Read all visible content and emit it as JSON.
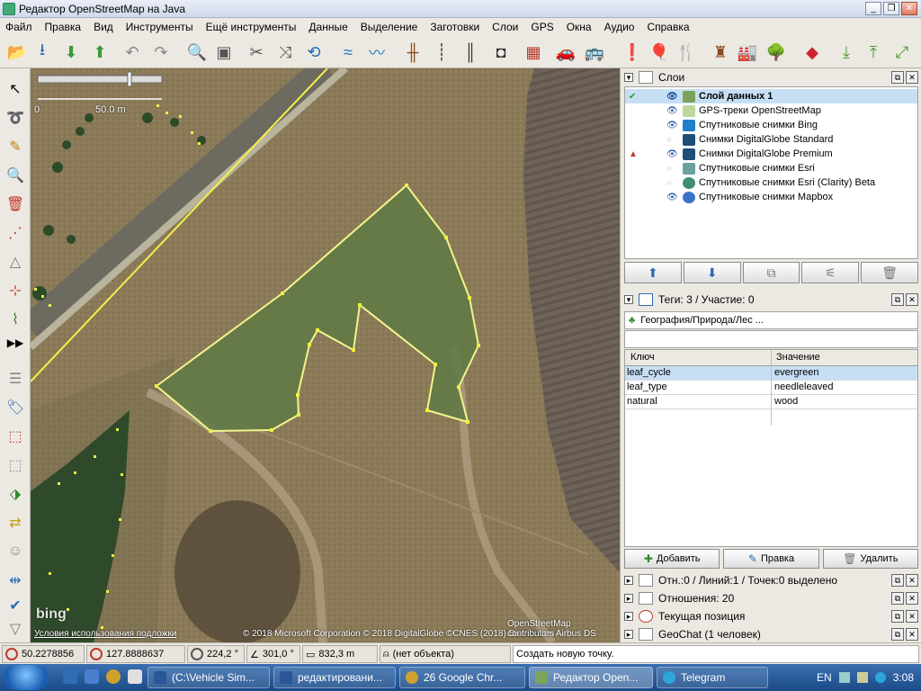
{
  "window": {
    "title": "Редактор OpenStreetMap на Java",
    "min_label": "_",
    "max_label": "❐",
    "close_label": "✕"
  },
  "menu": [
    "Файл",
    "Правка",
    "Вид",
    "Инструменты",
    "Ещё инструменты",
    "Данные",
    "Выделение",
    "Заготовки",
    "Слои",
    "GPS",
    "Окна",
    "Аудио",
    "Справка"
  ],
  "map": {
    "scale_zero": "0",
    "scale_label": "50.0 m",
    "bing_logo": "bing",
    "terms_link": "Условия использования подложки",
    "copyright": "© 2018 Microsoft Corporation © 2018 DigitalGlobe ©CNES (2018) Distribution Airbus DS",
    "osm_contrib": "OpenStreetMap contributors",
    "colors": {
      "polygon": "#f2f58a",
      "nodes": "#f0f040",
      "road": "#f4ef4a"
    }
  },
  "layers_panel": {
    "title": "Слои",
    "layers": [
      {
        "name": "Слой данных 1",
        "active": true,
        "visible": true,
        "icon": "data-layer-icon",
        "color": "#7aa45a"
      },
      {
        "name": "GPS-треки OpenStreetMap",
        "active": false,
        "visible": true,
        "icon": "gps-track-icon",
        "color": "#bcd89c"
      },
      {
        "name": "Спутниковые снимки Bing",
        "active": false,
        "visible": true,
        "icon": "bing-icon",
        "color": "#1f7fc8"
      },
      {
        "name": "Снимки DigitalGlobe Standard",
        "active": false,
        "visible": false,
        "icon": "digitalglobe-icon",
        "color": "#1f4e79"
      },
      {
        "name": "Снимки DigitalGlobe Premium",
        "active": false,
        "visible": true,
        "icon": "digitalglobe-icon",
        "color": "#1f4e79"
      },
      {
        "name": "Спутниковые снимки Esri",
        "active": false,
        "visible": false,
        "icon": "esri-icon",
        "color": "#6aa0a0"
      },
      {
        "name": "Спутниковые снимки Esri (Clarity) Beta",
        "active": false,
        "visible": false,
        "icon": "esri-globe-icon",
        "color": "#3f8f6f"
      },
      {
        "name": "Спутниковые снимки Mapbox",
        "active": false,
        "visible": true,
        "icon": "mapbox-icon",
        "color": "#3b73c9"
      }
    ]
  },
  "tags_panel": {
    "title": "Теги: 3 / Участие: 0",
    "preset": "География/Природа/Лес ...",
    "col_key": "Ключ",
    "col_value": "Значение",
    "rows": [
      {
        "key": "leaf_cycle",
        "value": "evergreen"
      },
      {
        "key": "leaf_type",
        "value": "needleleaved"
      },
      {
        "key": "natural",
        "value": "wood"
      }
    ],
    "add_label": "Добавить",
    "edit_label": "Правка",
    "delete_label": "Удалить"
  },
  "collapsed_panels": [
    {
      "title": "Отн.:0 / Линий:1 / Точек:0 выделено",
      "icon": "selection-icon"
    },
    {
      "title": "Отношения: 20",
      "icon": "relations-icon"
    },
    {
      "title": "Текущая позиция",
      "icon": "position-icon"
    },
    {
      "title": "GeoChat (1 человек)",
      "icon": "geochat-icon"
    }
  ],
  "statusbar": {
    "lat": "50.2278856",
    "lon": "127.8888637",
    "heading": "224,2 °",
    "angle": "301,0 °",
    "distance": "832,3 m",
    "object": "(нет объекта)",
    "hint": "Создать новую точку."
  },
  "taskbar": {
    "items": [
      {
        "label": "(C:\\Vehicle Sim...",
        "icon": "word-icon"
      },
      {
        "label": "редактировани...",
        "icon": "word-icon"
      },
      {
        "label": "26  Google Chr...",
        "icon": "chrome-icon"
      },
      {
        "label": "Редактор Open...",
        "icon": "josm-icon"
      },
      {
        "label": "Telegram",
        "icon": "telegram-icon"
      }
    ],
    "lang": "EN",
    "time": "3:08"
  }
}
